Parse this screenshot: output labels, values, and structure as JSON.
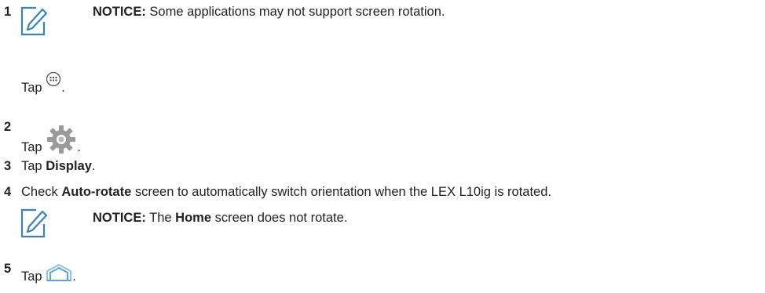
{
  "notice1": {
    "number": "1",
    "label": "NOTICE:",
    "text": " Some applications may not support screen rotation."
  },
  "step_tap_apps": {
    "pre": "Tap ",
    "post": "."
  },
  "step2": {
    "number": "2",
    "pre": "Tap ",
    "post": "."
  },
  "step3": {
    "number": "3",
    "pre": "Tap ",
    "bold": "Display",
    "post": "."
  },
  "step4": {
    "number": "4",
    "pre": "Check ",
    "bold": "Auto-rotate",
    "post": " screen to automatically switch orientation when the LEX L10ig is rotated."
  },
  "notice2": {
    "label": "NOTICE:",
    "pre": " The ",
    "bold": "Home",
    "post": " screen does not rotate."
  },
  "step5": {
    "number": "5",
    "pre": "Tap ",
    "post": "."
  },
  "icons": {
    "notice": "notice-pencil-icon",
    "apps": "apps-grid-icon",
    "settings": "settings-gear-icon",
    "home": "home-icon"
  },
  "colors": {
    "icon_stroke": "#3a82b8",
    "gear": "#9a9a9a",
    "text": "#222222"
  }
}
